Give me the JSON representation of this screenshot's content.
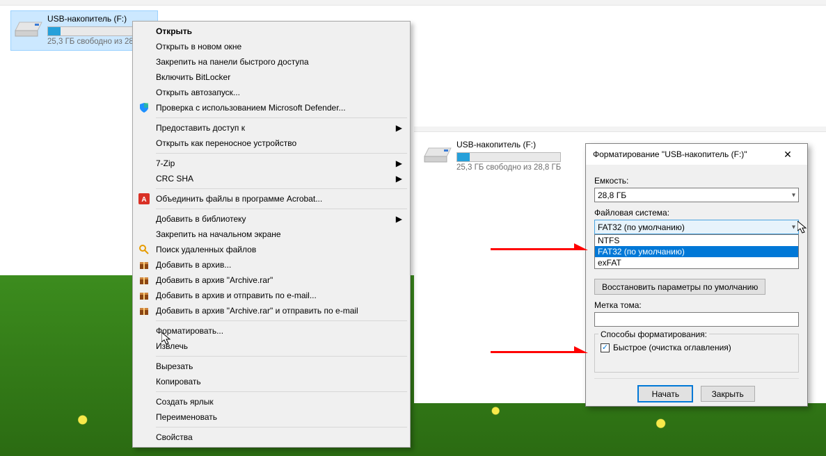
{
  "drive1": {
    "name": "USB-накопитель (F:)",
    "free": "25,3 ГБ свободно из 28"
  },
  "drive2": {
    "name": "USB-накопитель (F:)",
    "free": "25,3 ГБ свободно из 28,8 ГБ"
  },
  "ctx": {
    "open": "Открыть",
    "open_new": "Открыть в новом окне",
    "pin_quick": "Закрепить на панели быстрого доступа",
    "bitlocker": "Включить BitLocker",
    "autoplay": "Открыть автозапуск...",
    "defender": "Проверка с использованием Microsoft Defender...",
    "share": "Предоставить доступ к",
    "portable": "Открыть как переносное устройство",
    "zip": "7-Zip",
    "crc": "CRC SHA",
    "acrobat": "Объединить файлы в программе Acrobat...",
    "library": "Добавить в библиотеку",
    "pin_start": "Закрепить на начальном экране",
    "search_deleted": "Поиск удаленных файлов",
    "add_archive": "Добавить в архив...",
    "add_archive_rar": "Добавить в архив \"Archive.rar\"",
    "add_archive_mail": "Добавить в архив и отправить по e-mail...",
    "add_archive_rar_mail": "Добавить в архив \"Archive.rar\" и отправить по e-mail",
    "format": "Форматировать...",
    "eject": "Извлечь",
    "cut": "Вырезать",
    "copy": "Копировать",
    "shortcut": "Создать ярлык",
    "rename": "Переименовать",
    "props": "Свойства"
  },
  "dlg": {
    "title": "Форматирование \"USB-накопитель (F:)\"",
    "capacity_lbl": "Емкость:",
    "capacity_val": "28,8 ГБ",
    "fs_lbl": "Файловая система:",
    "fs_val": "FAT32 (по умолчанию)",
    "fs_opts": {
      "ntfs": "NTFS",
      "fat32": "FAT32 (по умолчанию)",
      "exfat": "exFAT"
    },
    "restore": "Восстановить параметры по умолчанию",
    "label_lbl": "Метка тома:",
    "label_val": "",
    "ways_lbl": "Способы форматирования:",
    "quick": "Быстрое (очистка оглавления)",
    "start": "Начать",
    "close": "Закрыть"
  }
}
